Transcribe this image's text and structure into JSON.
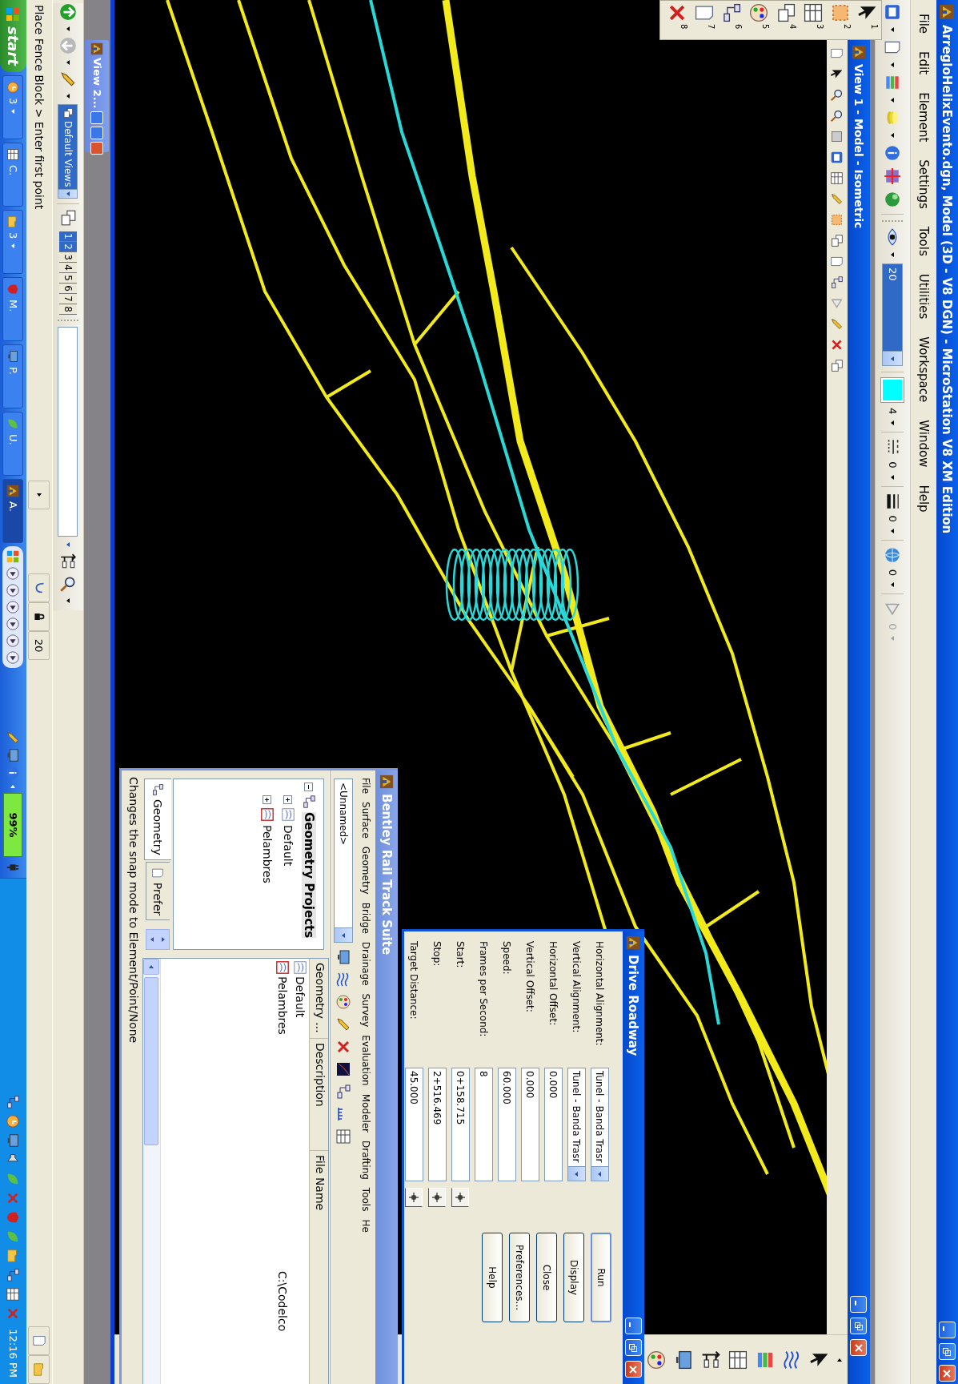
{
  "window": {
    "title": "ArregloHelixEvento.dgn, Model (3D - V8 DGN) - MicroStation V8 XM Edition"
  },
  "menu_bar": [
    "File",
    "Edit",
    "Element",
    "Settings",
    "Tools",
    "Utilities",
    "Workspace",
    "Window",
    "Help"
  ],
  "attributes_toolbar": {
    "level": "20",
    "values": [
      {
        "text": "4",
        "kind": "swatch",
        "disabled": false
      },
      {
        "text": "0",
        "kind": "dashes",
        "disabled": false
      },
      {
        "text": "0",
        "kind": "bars",
        "disabled": false
      },
      {
        "text": "0",
        "kind": "globe",
        "disabled": false
      },
      {
        "text": "0",
        "kind": "triangle",
        "disabled": true
      }
    ]
  },
  "tool_palette": [
    "1",
    "2",
    "3",
    "4",
    "5",
    "6",
    "7",
    "8"
  ],
  "view_1": {
    "title": "View 1 - Model - Isometric"
  },
  "view_2": {
    "title": "View 2..."
  },
  "drive_roadway": {
    "title": "Drive Roadway",
    "fields": [
      {
        "label": "Horizontal Alignment:",
        "value": "Tunel - Banda Trasr",
        "kind": "dropdown"
      },
      {
        "label": "Vertical Alignment:",
        "value": "Tunel - Banda Trasr",
        "kind": "dropdown"
      },
      {
        "label": "Horizontal Offset:",
        "value": "0.000",
        "kind": "text"
      },
      {
        "label": "Vertical Offset:",
        "value": "0.000",
        "kind": "text"
      },
      {
        "label": "Speed:",
        "value": "60.000",
        "kind": "text"
      },
      {
        "label": "Frames per Second:",
        "value": "8",
        "kind": "text"
      },
      {
        "label": "Start:",
        "value": "0+158.715",
        "kind": "station"
      },
      {
        "label": "Stop:",
        "value": "2+516.469",
        "kind": "station"
      },
      {
        "label": "Target Distance:",
        "value": "45.000",
        "kind": "station"
      }
    ],
    "buttons": [
      {
        "label": "Run",
        "focused": true
      },
      {
        "label": "Display",
        "focused": false
      },
      {
        "label": "Close",
        "focused": false
      },
      {
        "label": "Preferences...",
        "focused": false
      },
      {
        "label": "Help",
        "focused": false
      }
    ]
  },
  "rail_track_suite": {
    "title": "Bentley Rail Track Suite",
    "menu": [
      "File",
      "Surface",
      "Geometry",
      "Bridge",
      "Drainage",
      "Survey",
      "Evaluation",
      "Modeler",
      "Drafting",
      "Tools",
      "He"
    ],
    "project": "<Unnamed>",
    "tree": [
      {
        "label": "Geometry Projects",
        "expanded": true,
        "selected": true,
        "children": [
          {
            "label": "Default",
            "expanded": false,
            "selected": false,
            "active": false
          },
          {
            "label": "Pelambres",
            "expanded": false,
            "selected": false,
            "active": true
          }
        ]
      }
    ],
    "tabs": [
      {
        "label": "Geometry",
        "selected": true
      },
      {
        "label": "Prefer",
        "selected": false
      }
    ],
    "columns": [
      "Geometry ...",
      "Description",
      "File Name"
    ],
    "rows": [
      {
        "name": "Default",
        "active": false
      },
      {
        "name": "Pelambres",
        "active": true,
        "file_name": "C:\\Codelco"
      }
    ],
    "status": "Changes the snap mode to Element/Point/None"
  },
  "view_bar": {
    "views": "Default Views",
    "view_buttons": [
      {
        "label": "1",
        "selected": true
      },
      {
        "label": "2",
        "selected": true
      },
      {
        "label": "3",
        "selected": false
      },
      {
        "label": "4",
        "selected": false
      },
      {
        "label": "5",
        "selected": false
      },
      {
        "label": "6",
        "selected": false
      },
      {
        "label": "7",
        "selected": false
      },
      {
        "label": "8",
        "selected": false
      }
    ]
  },
  "status_bar": {
    "prompt": "Place Fence Block > Enter first point",
    "value": "20"
  },
  "taskbar": {
    "start": "start",
    "buttons": [
      {
        "label": "3",
        "grouped": true,
        "selected": false
      },
      {
        "label": "C.",
        "grouped": false,
        "selected": false
      },
      {
        "label": "3",
        "grouped": true,
        "selected": false
      },
      {
        "label": "M.",
        "grouped": false,
        "selected": false
      },
      {
        "label": "P.",
        "grouped": false,
        "selected": false
      },
      {
        "label": "U.",
        "grouped": false,
        "selected": false
      },
      {
        "label": "A.",
        "grouped": false,
        "selected": true
      }
    ],
    "battery": "99%",
    "clock": "12:16 PM"
  }
}
